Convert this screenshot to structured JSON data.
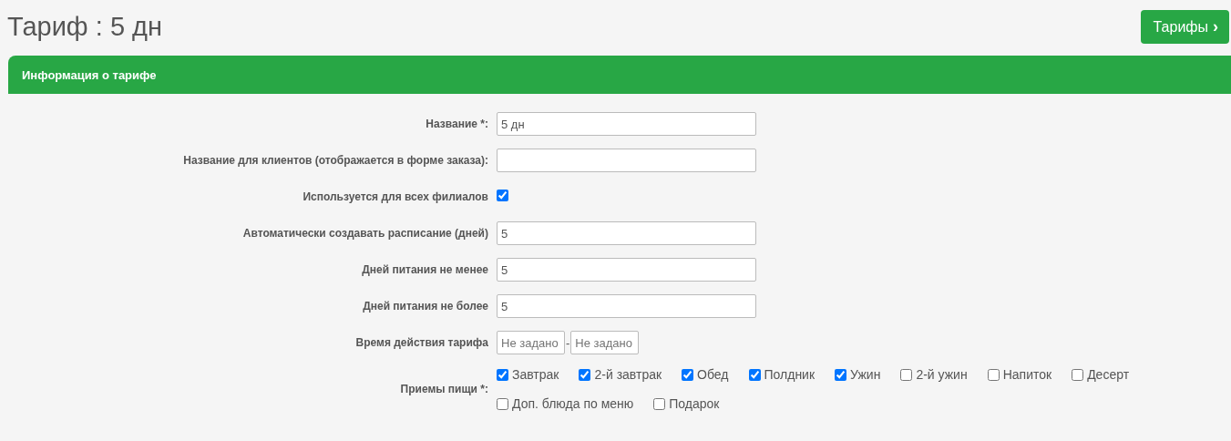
{
  "title": "Тариф : 5 дн",
  "nav_button": {
    "label": "Тарифы",
    "icon": "›"
  },
  "panel": {
    "title": "Информация о тарифе",
    "fields": [
      {
        "kind": "text",
        "label": "Название *:",
        "value": "5 дн"
      },
      {
        "kind": "text",
        "label": "Название для клиентов (отображается в форме заказа):"
      },
      {
        "kind": "checkbox",
        "label": "Используется для всех филиалов",
        "checked": true
      },
      {
        "kind": "text",
        "label": "Автоматически создавать расписание (дней)",
        "value": "5"
      },
      {
        "kind": "text",
        "label": "Дней питания не менее",
        "value": "5"
      },
      {
        "kind": "text",
        "label": "Дней питания не более",
        "value": "5"
      },
      {
        "kind": "range",
        "label": "Время действия тарифа",
        "from_placeholder": "Не задано",
        "separator": "-",
        "to_placeholder": "Не задано"
      },
      {
        "kind": "options",
        "label": "Приемы пищи *:",
        "options": [
          {
            "label": "Завтрак",
            "checked": true
          },
          {
            "label": "2-й завтрак",
            "checked": true
          },
          {
            "label": "Обед",
            "checked": true
          },
          {
            "label": "Полдник",
            "checked": true
          },
          {
            "label": "Ужин",
            "checked": true
          },
          {
            "label": "2-й ужин",
            "checked": false
          },
          {
            "label": "Напиток",
            "checked": false
          },
          {
            "label": "Десерт",
            "checked": false
          },
          {
            "label": "Доп. блюда по меню",
            "checked": false
          },
          {
            "label": "Подарок",
            "checked": false
          }
        ]
      }
    ]
  }
}
